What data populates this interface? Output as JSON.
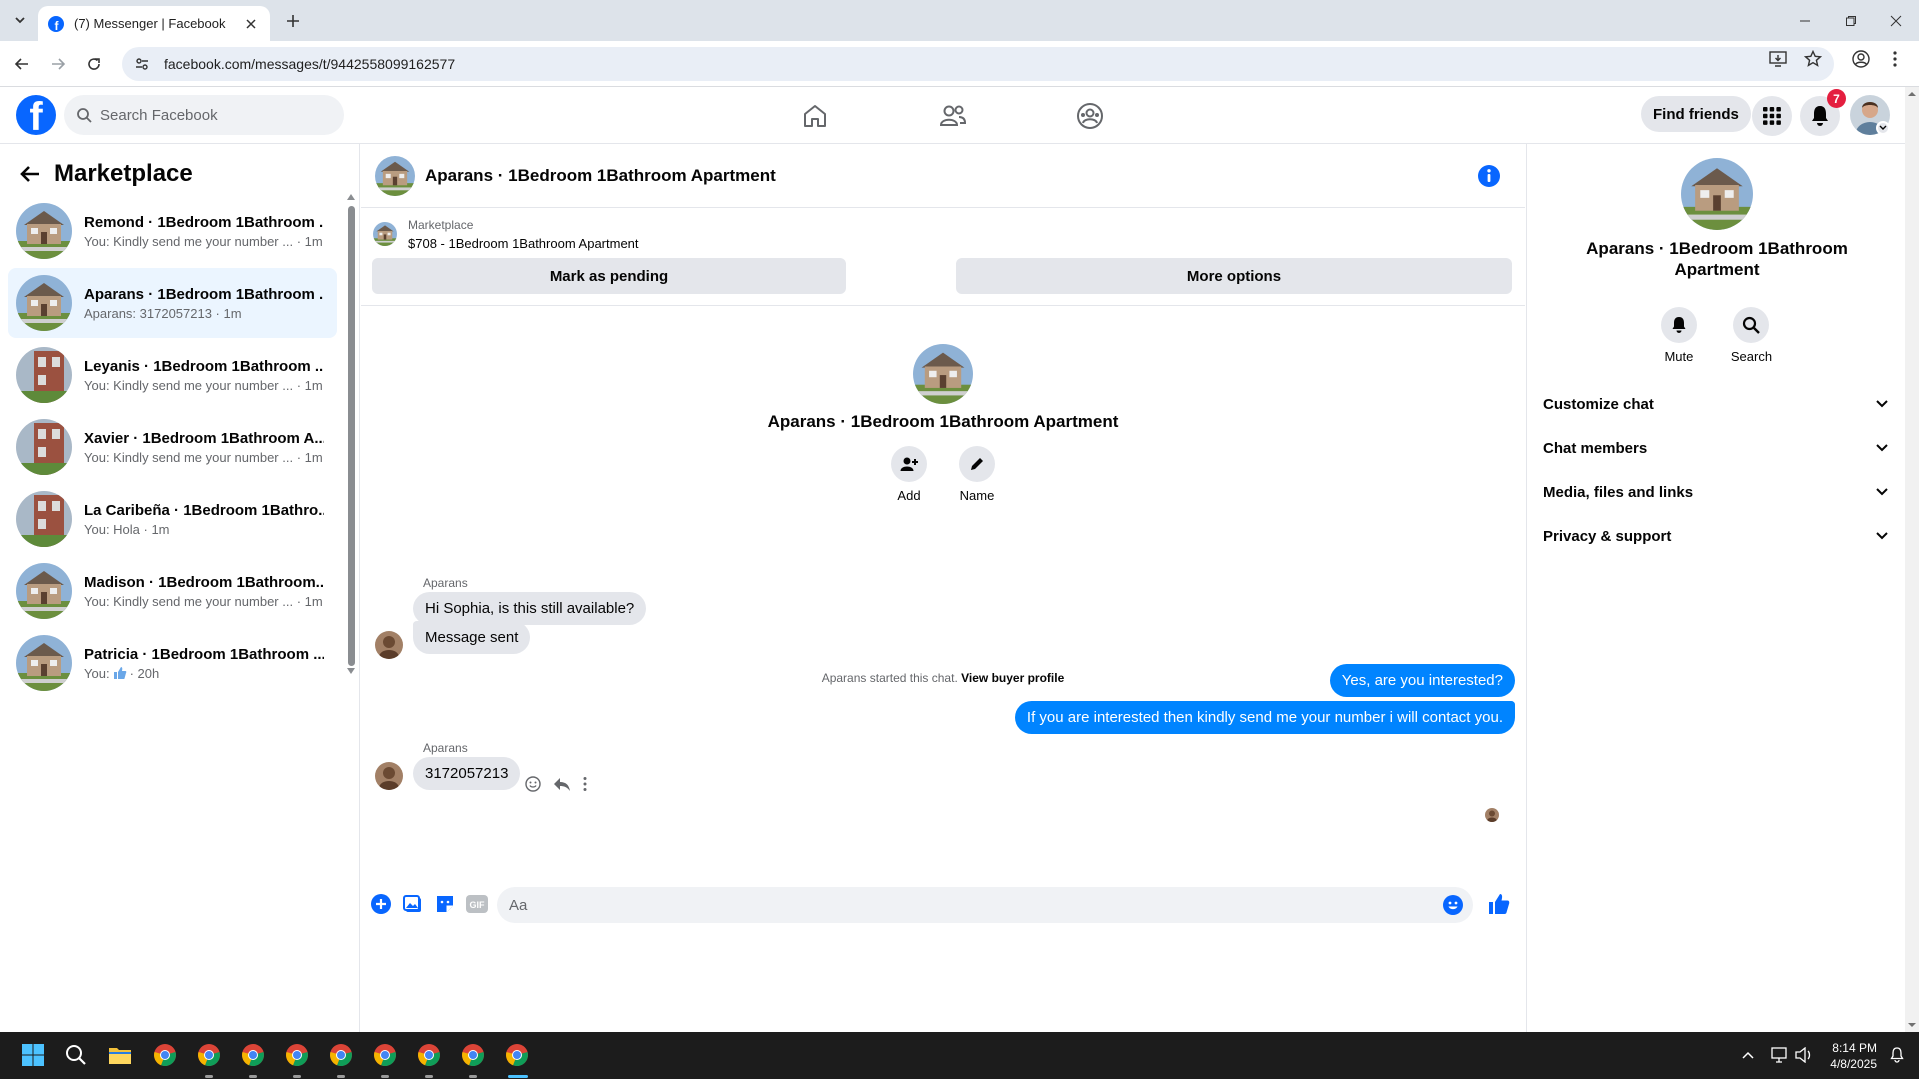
{
  "browser": {
    "tab_title": "(7) Messenger | Facebook",
    "url": "facebook.com/messages/t/9442558099162577"
  },
  "header": {
    "search_placeholder": "Search Facebook",
    "find_friends": "Find friends",
    "notification_count": "7"
  },
  "sidebar": {
    "title": "Marketplace",
    "conversations": [
      {
        "name": "Remond · 1Bedroom 1Bathroom ...",
        "preview": "You: Kindly send me your number ... · 1m"
      },
      {
        "name": "Aparans · 1Bedroom 1Bathroom ...",
        "preview": "Aparans: 3172057213 · 1m",
        "active": true
      },
      {
        "name": "Leyanis · 1Bedroom 1Bathroom ...",
        "preview": "You: Kindly send me your number ... · 1m"
      },
      {
        "name": "Xavier · 1Bedroom 1Bathroom A...",
        "preview": "You: Kindly send me your number ... · 1m"
      },
      {
        "name": "La Caribeña · 1Bedroom 1Bathro...",
        "preview": "You: Hola · 1m"
      },
      {
        "name": "Madison · 1Bedroom 1Bathroom...",
        "preview": "You: Kindly send me your number ... · 1m"
      },
      {
        "name": "Patricia · 1Bedroom 1Bathroom ...",
        "preview_prefix": "You:",
        "preview_suffix": "· 20h"
      }
    ]
  },
  "chat": {
    "title": "Aparans · 1Bedroom 1Bathroom Apartment",
    "marketplace_label": "Marketplace",
    "listing": "$708 - 1Bedroom 1Bathroom Apartment",
    "mark_pending": "Mark as pending",
    "more_options": "More options",
    "intro_name": "Aparans · 1Bedroom 1Bathroom Apartment",
    "add_label": "Add",
    "name_label": "Name",
    "started_text": "Aparans started this chat.",
    "view_buyer": "View buyer profile",
    "sender": "Aparans",
    "messages_in_1": [
      "Hi Sophia, is this still available?",
      "Message sent"
    ],
    "messages_out": [
      "Yes, are you interested?",
      "If you are interested then kindly send me your number i will contact you."
    ],
    "message_in_2": "3172057213",
    "composer_placeholder": "Aa"
  },
  "details": {
    "name": "Aparans · 1Bedroom 1Bathroom Apartment",
    "mute": "Mute",
    "search": "Search",
    "sections": [
      "Customize chat",
      "Chat members",
      "Media, files and links",
      "Privacy & support"
    ]
  },
  "taskbar": {
    "time": "8:14 PM",
    "date": "4/8/2025"
  },
  "colors": {
    "fb_blue": "#0866ff",
    "messenger_blue": "#0084ff",
    "notification_red": "#e41e3f"
  }
}
